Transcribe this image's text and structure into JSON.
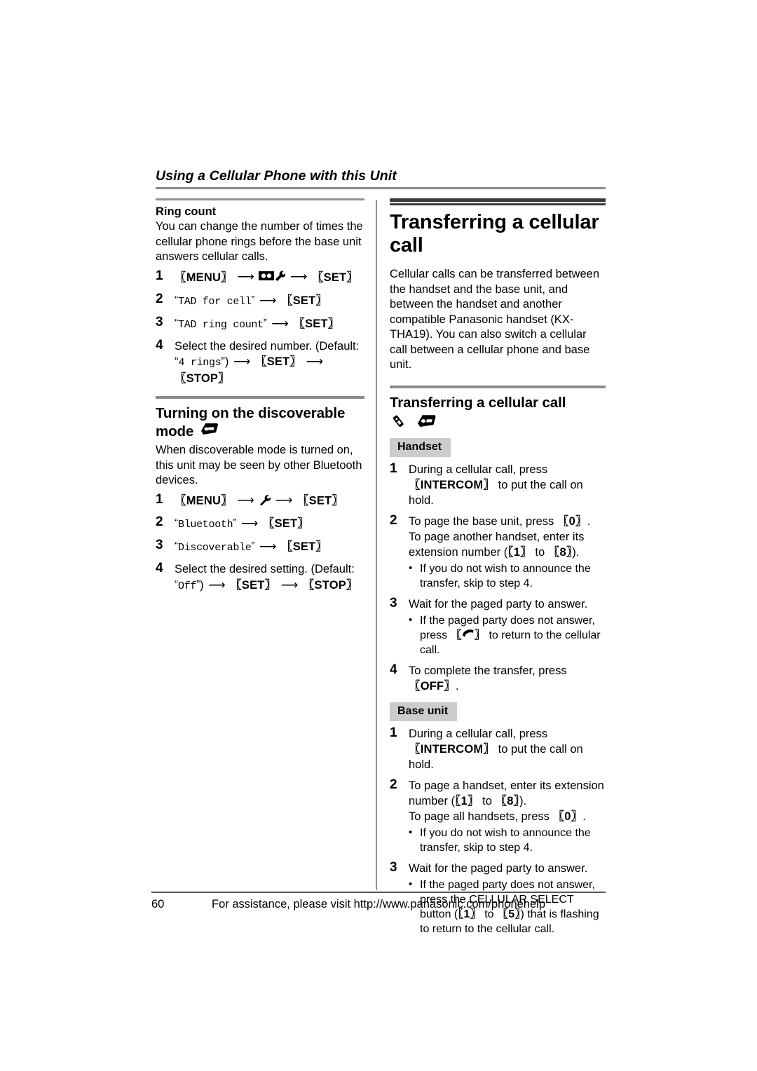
{
  "header": {
    "title": "Using a Cellular Phone with this Unit"
  },
  "left_column": {
    "section1": {
      "subheading": "Ring count",
      "intro": "You can change the number of times the cellular phone rings before the base unit answers cellular calls.",
      "steps": [
        {
          "num": "1",
          "parts": [
            "[MENU]",
            "→",
            "tape-wrench-icon",
            "→",
            "[SET]"
          ],
          "text_plain": "[MENU] → (TAD/settings icon) → [SET]",
          "key1": "MENU",
          "key2": "SET"
        },
        {
          "num": "2",
          "quoted": "TAD for cell",
          "key": "SET"
        },
        {
          "num": "3",
          "quoted": "TAD ring count",
          "key": "SET"
        },
        {
          "num": "4",
          "lead": "Select the desired number. (Default: “",
          "default_value": "4 rings",
          "tail": "”)",
          "key1": "SET",
          "key2": "STOP"
        }
      ]
    },
    "section2": {
      "heading": "Turning on the discoverable mode",
      "heading_icon": "base-unit-icon",
      "intro": "When discoverable mode is turned on, this unit may be seen by other Bluetooth devices.",
      "steps": [
        {
          "num": "1",
          "key1": "MENU",
          "icon": "wrench-icon",
          "key2": "SET"
        },
        {
          "num": "2",
          "quoted": "Bluetooth",
          "key": "SET"
        },
        {
          "num": "3",
          "quoted": "Discoverable",
          "key": "SET"
        },
        {
          "num": "4",
          "lead": "Select the desired setting. (Default:",
          "default_value": "Off",
          "tail": "”)",
          "key1": "SET",
          "key2": "STOP"
        }
      ]
    }
  },
  "right_column": {
    "title": "Transferring a cellular call",
    "intro": "Cellular calls can be transferred between the handset and the base unit, and between the handset and another compatible Panasonic handset (KX-THA19). You can also switch a cellular call between a cellular phone and base unit.",
    "subtitle": "Transferring a cellular call",
    "subtitle_icons": [
      "handset-icon",
      "base-unit-icon"
    ],
    "handset": {
      "badge": "Handset",
      "steps": [
        {
          "num": "1",
          "text_a": "During a cellular call, press",
          "key": "INTERCOM",
          "text_b": "to put the call on hold."
        },
        {
          "num": "2",
          "line1_a": "To page the base unit, press",
          "line1_key": "0",
          "line1_b": ".",
          "line2": "To page another handset, enter its extension number (",
          "key_from": "1",
          "key_to_word": "to",
          "key_to": "8",
          "line2_tail": ").",
          "bullet": "If you do not wish to announce the transfer, skip to step 4."
        },
        {
          "num": "3",
          "text": "Wait for the paged party to answer.",
          "bullet_a": "If the paged party does not answer, press",
          "bullet_icon": "talk-phone-icon",
          "bullet_b": "to return to the cellular call."
        },
        {
          "num": "4",
          "text_a": "To complete the transfer, press",
          "key": "OFF",
          "text_b": "."
        }
      ]
    },
    "base_unit": {
      "badge": "Base unit",
      "steps": [
        {
          "num": "1",
          "text_a": "During a cellular call, press",
          "key": "INTERCOM",
          "text_b": "to put the call on hold."
        },
        {
          "num": "2",
          "line1": "To page a handset, enter its extension number (",
          "key_from": "1",
          "key_to_word": "to",
          "key_to": "8",
          "line1_tail": ").",
          "line2_a": "To page all handsets, press",
          "line2_key": "0",
          "line2_b": ".",
          "bullet": "If you do not wish to announce the transfer, skip to step 4."
        },
        {
          "num": "3",
          "text": "Wait for the paged party to answer.",
          "bullet_a": "If the paged party does not answer, press the CELLULAR SELECT button (",
          "key_from": "1",
          "key_to_word": "to",
          "key_to": "5",
          "bullet_b": ") that is flashing to return to the cellular call."
        }
      ]
    }
  },
  "footer": {
    "page_number": "60",
    "text": "For assistance, please visit http://www.panasonic.com/phonehelp"
  },
  "colors": {
    "rule_gray": "#8a8a8a",
    "rule_dark": "#3b3b3b",
    "badge_bg": "#cccccc",
    "text": "#000000"
  }
}
